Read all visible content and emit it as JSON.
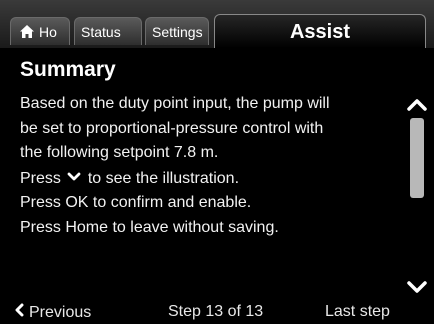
{
  "tabs": {
    "home": "Ho",
    "status": "Status",
    "settings": "Settings",
    "active": "Assist"
  },
  "title": "Summary",
  "body_lines": [
    "Based on the duty point input, the pump will",
    "be set to proportional-pressure control with",
    "the following setpoint  7.8 m.",
    "to see the illustration.",
    "Press OK to confirm and enable.",
    "Press Home to leave without saving."
  ],
  "press_label": "Press",
  "footer": {
    "previous": "Previous",
    "step": "Step 13 of 13",
    "last": "Last step"
  },
  "scroll_position": 0.0,
  "icons": {
    "home": "home-icon",
    "down": "chevron-down-icon",
    "up": "chevron-up-icon",
    "left": "chevron-left-icon"
  }
}
